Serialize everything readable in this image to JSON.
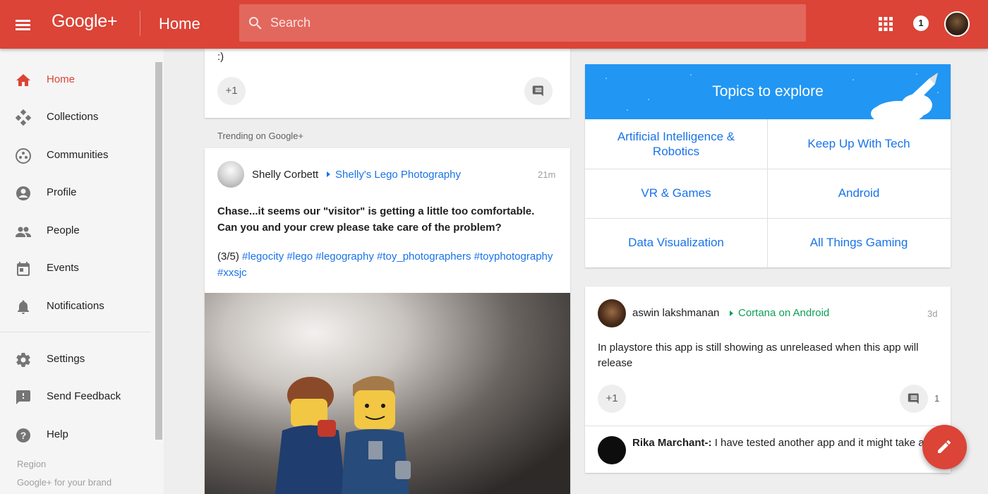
{
  "header": {
    "brand": "Google+",
    "page_title": "Home",
    "search_placeholder": "Search",
    "notification_count": "1"
  },
  "sidebar": {
    "items": [
      {
        "label": "Home",
        "icon": "home-icon",
        "active": true
      },
      {
        "label": "Collections",
        "icon": "collections-icon"
      },
      {
        "label": "Communities",
        "icon": "communities-icon"
      },
      {
        "label": "Profile",
        "icon": "profile-icon"
      },
      {
        "label": "People",
        "icon": "people-icon"
      },
      {
        "label": "Events",
        "icon": "events-icon"
      },
      {
        "label": "Notifications",
        "icon": "bell-icon"
      },
      {
        "label": "Settings",
        "icon": "gear-icon"
      },
      {
        "label": "Send Feedback",
        "icon": "feedback-icon"
      },
      {
        "label": "Help",
        "icon": "help-icon"
      }
    ],
    "footer": {
      "region": "Region",
      "brand_link": "Google+ for your brand"
    }
  },
  "feed": {
    "top_post": {
      "text": ":)",
      "plus_one": "+1"
    },
    "trending_label": "Trending on Google+",
    "post": {
      "author": "Shelly Corbett",
      "community": "Shelly's Lego Photography",
      "time": "21m",
      "text": "Chase...it seems our \"visitor\" is getting a little too comfortable. Can you and your crew please take care of the problem?",
      "counter": "(3/5)",
      "hashtags": [
        "#legocity",
        "#lego",
        "#legography",
        "#toy_photographers",
        "#toyphotography",
        "#xxsjc"
      ]
    }
  },
  "topics": {
    "title": "Topics to explore",
    "items": [
      "Artificial Intelligence & Robotics",
      "Keep Up With Tech",
      "VR & Games",
      "Android",
      "Data Visualization",
      "All Things Gaming"
    ]
  },
  "post2": {
    "author": "aswin lakshmanan",
    "community": "Cortana on Android",
    "time": "3d",
    "text": "In playstore this app is still showing as unreleased when this app will release",
    "plus_one": "+1",
    "comment_count": "1",
    "comment_author": "Rika Marchant-:",
    "comment_text": " I have tested another app and it might take a couple of days for Google to check things out sometimes the"
  },
  "colors": {
    "brand_red": "#db4437",
    "link_blue": "#1a73e8",
    "topics_blue": "#2196f3",
    "community_green": "#0f9d58"
  }
}
